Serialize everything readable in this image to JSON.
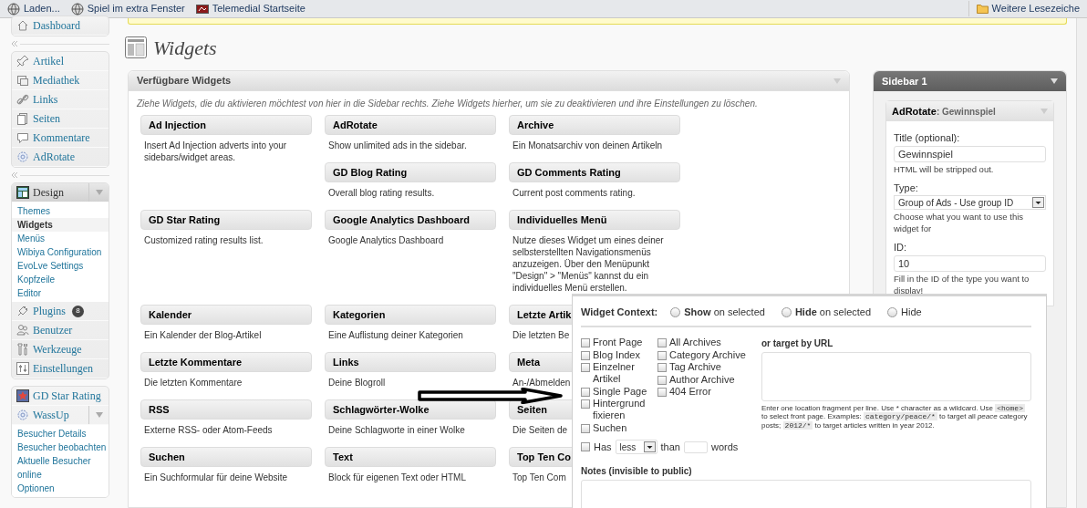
{
  "bookmarks": [
    {
      "label": "Laden..."
    },
    {
      "label": "Spiel im extra Fenster"
    },
    {
      "label": "Telemedial Startseite"
    }
  ],
  "bookmarks_more": "Weitere Lesezeiche",
  "menu": [
    {
      "separator_before": false,
      "items": [
        {
          "label": "Dashboard",
          "selected": false,
          "expanded": false
        }
      ]
    },
    {
      "separator_before": true,
      "items": [
        {
          "label": "Artikel",
          "selected": false,
          "expanded": false
        },
        {
          "label": "Mediathek",
          "selected": false,
          "expanded": false
        },
        {
          "label": "Links",
          "selected": false,
          "expanded": false
        },
        {
          "label": "Seiten",
          "selected": false,
          "expanded": false
        },
        {
          "label": "Kommentare",
          "selected": false,
          "expanded": false
        },
        {
          "label": "AdRotate",
          "selected": false,
          "expanded": false
        }
      ]
    },
    {
      "separator_before": true,
      "items": [
        {
          "label": "Design",
          "selected": true,
          "expanded": true,
          "submenu": [
            {
              "label": "Themes",
              "selected": false
            },
            {
              "label": "Widgets",
              "selected": true
            },
            {
              "label": "Menüs",
              "selected": false
            },
            {
              "label": "Wibiya Configuration",
              "selected": false
            },
            {
              "label": "EvoLve Settings",
              "selected": false
            },
            {
              "label": "Kopfzeile",
              "selected": false
            },
            {
              "label": "Editor",
              "selected": false
            }
          ]
        },
        {
          "label": "Plugins",
          "selected": false,
          "expanded": false,
          "badge": "8"
        },
        {
          "label": "Benutzer",
          "selected": false,
          "expanded": false
        },
        {
          "label": "Werkzeuge",
          "selected": false,
          "expanded": false
        },
        {
          "label": "Einstellungen",
          "selected": false,
          "expanded": false
        }
      ]
    },
    {
      "separator_before": false,
      "items": [
        {
          "label": "GD Star Rating",
          "selected": false,
          "expanded": false
        },
        {
          "label": "WassUp",
          "selected": false,
          "expanded": true,
          "submenu": [
            {
              "label": "Besucher Details",
              "selected": false
            },
            {
              "label": "Besucher beobachten",
              "selected": false
            },
            {
              "label": "Aktuelle Besucher online",
              "selected": false
            },
            {
              "label": "Optionen",
              "selected": false
            }
          ]
        }
      ]
    }
  ],
  "page_title": "Widgets",
  "available": {
    "title": "Verfügbare Widgets",
    "description": "Ziehe Widgets, die du aktivieren möchtest von hier in die Sidebar rechts. Ziehe Widgets hierher, um sie zu deaktivieren und ihre Einstellungen zu löschen.",
    "widgets": [
      {
        "title": "Ad Injection",
        "description": "Insert Ad Injection adverts into your sidebars/widget areas."
      },
      {
        "title": "AdRotate",
        "description": "Show unlimited ads in the sidebar."
      },
      {
        "title": "Archive",
        "description": "Ein Monatsarchiv von deinen Artikeln"
      },
      {
        "title": "GD Blog Rating",
        "description": "Overall blog rating results."
      },
      {
        "title": "GD Comments Rating",
        "description": "Current post comments rating."
      },
      {
        "title": "GD Star Rating",
        "description": "Customized rating results list."
      },
      {
        "title": "Google Analytics Dashboard",
        "description": "Google Analytics Dashboard"
      },
      {
        "title": "Individuelles Menü",
        "description": "Nutze dieses Widget um eines deiner selbsterstellten Navigationsmenüs anzuzeigen. Über den Menüpunkt \"Design\" > \"Menüs\" kannst du ein individuelles Menü erstellen."
      },
      {
        "title": "Kalender",
        "description": "Ein Kalender der Blog-Artikel"
      },
      {
        "title": "Kategorien",
        "description": "Eine Auflistung deiner Kategorien"
      },
      {
        "title": "Letzte Artik",
        "description": "Die letzten Be"
      },
      {
        "title": "Letzte Kommentare",
        "description": "Die letzten Kommentare"
      },
      {
        "title": "Links",
        "description": "Deine Blogroll"
      },
      {
        "title": "Meta",
        "description": "An-/Abmelden"
      },
      {
        "title": "RSS",
        "description": "Externe RSS- oder Atom-Feeds"
      },
      {
        "title": "Schlagwörter-Wolke",
        "description": "Deine Schlagworte in einer Wolke"
      },
      {
        "title": "Seiten",
        "description": "Die Seiten de"
      },
      {
        "title": "Suchen",
        "description": "Ein Suchformular für deine Website"
      },
      {
        "title": "Text",
        "description": "Block für eigenen Text oder HTML"
      },
      {
        "title": "Top Ten Co",
        "description": "Top Ten Com"
      }
    ]
  },
  "sidebar": {
    "title": "Sidebar 1",
    "widget": {
      "name": "AdRotate",
      "suffix": ": Gewinnspiel",
      "fields": [
        {
          "kind": "text",
          "label": "Title (optional):",
          "value": "Gewinnspiel",
          "hint": "HTML will be stripped out."
        },
        {
          "kind": "select",
          "label": "Type:",
          "value": "Group of Ads - Use group ID",
          "hint": "Choose what you want to use this widget for"
        },
        {
          "kind": "text",
          "label": "ID:",
          "value": "10",
          "hint": "Fill in the ID of the type you want to display!"
        }
      ]
    }
  },
  "context": {
    "label": "Widget Context:",
    "modes": [
      {
        "label": "**Show** on selected",
        "selected": false
      },
      {
        "label": "**Hide** on selected",
        "selected": false
      },
      {
        "label": "Hide",
        "selected": false
      }
    ],
    "columns": [
      [
        {
          "label": "Front Page",
          "checked": false
        },
        {
          "label": "Blog Index",
          "checked": false
        },
        {
          "label": "Einzelner Artikel",
          "checked": false
        },
        {
          "label": "Single Page",
          "checked": false
        },
        {
          "label": "Hintergrund fixieren",
          "checked": false
        },
        {
          "label": "Suchen",
          "checked": false
        }
      ],
      [
        {
          "label": "All Archives",
          "checked": false
        },
        {
          "label": "Category Archive",
          "checked": false
        },
        {
          "label": "Tag Archive",
          "checked": false
        },
        {
          "label": "Author Archive",
          "checked": false
        },
        {
          "label": "404 Error",
          "checked": false
        }
      ]
    ],
    "url": {
      "label": "or target by URL",
      "help": [
        {
          "kind": "text",
          "text": "Enter one location fragment per line. Use * character as a wildcard. Use "
        },
        {
          "kind": "code",
          "text": "<home>"
        },
        {
          "kind": "text",
          "text": " to select front page. Examples: "
        },
        {
          "kind": "code",
          "text": "category/peace/*"
        },
        {
          "kind": "text",
          "text": " to target all "
        },
        {
          "kind": "em",
          "text": "peace"
        },
        {
          "kind": "text",
          "text": " category posts; "
        },
        {
          "kind": "code",
          "text": "2012/*"
        },
        {
          "kind": "text",
          "text": " to target articles written in year 2012."
        }
      ]
    },
    "word_count": {
      "checked": false,
      "prefix": "Has",
      "operator": "less",
      "middle": "than",
      "suffix": "words"
    },
    "notes": {
      "label": "Notes (invisible to public)"
    }
  }
}
